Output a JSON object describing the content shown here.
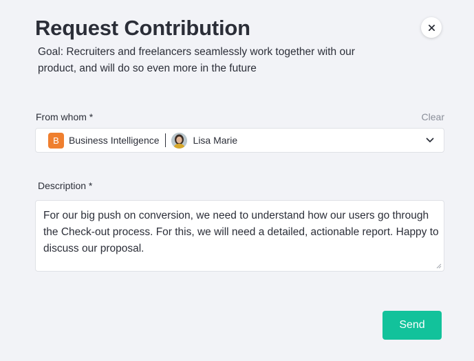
{
  "dialog": {
    "title": "Request Contribution",
    "goal": "Goal: Recruiters and freelancers seamlessly work together with our product, and will do so even more in the future"
  },
  "from_whom": {
    "label": "From whom *",
    "clear_label": "Clear",
    "team": {
      "initial": "B",
      "name": "Business Intelligence",
      "color": "#ef7f2f"
    },
    "user": {
      "name": "Lisa Marie"
    }
  },
  "description": {
    "label": "Description *",
    "value": "For our big push on conversion, we need to understand how our users go through the Check-out process. For this, we will need a detailed, actionable report. Happy to discuss our proposal."
  },
  "actions": {
    "send_label": "Send",
    "send_color": "#12c29b"
  },
  "icons": {
    "close": "close-icon",
    "chevron": "chevron-down-icon",
    "resize": "resize-grip-icon"
  }
}
